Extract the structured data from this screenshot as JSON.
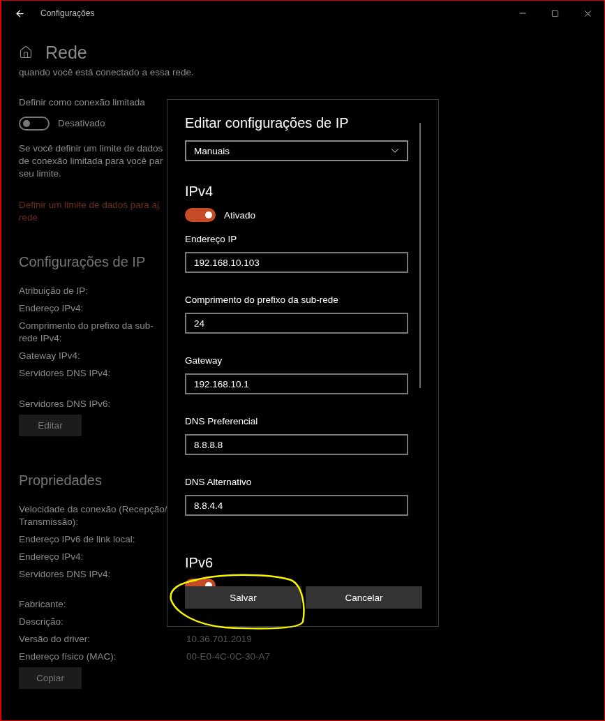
{
  "window": {
    "title": "Configurações"
  },
  "page": {
    "title": "Rede"
  },
  "metered": {
    "intro": "quando você está conectado a essa rede.",
    "label": "Definir como conexão limitada",
    "toggle": {
      "on": false,
      "label": "Desativado"
    },
    "description": [
      "Se você definir um limite de dados",
      "de conexão limitada para você par",
      "seu limite."
    ],
    "link": [
      "Definir um limite de dados para aj",
      "rede"
    ]
  },
  "ip_settings": {
    "title": "Configurações de IP",
    "groups": [
      [
        {
          "label": [
            "Atribuição de IP:"
          ]
        },
        {
          "label": [
            "Endereço IPv4:"
          ]
        },
        {
          "label": [
            "Comprimento do prefixo da sub-",
            "rede IPv4:"
          ]
        },
        {
          "label": [
            "Gateway IPv4:"
          ]
        },
        {
          "label": [
            "Servidores DNS IPv4:"
          ]
        }
      ],
      [
        {
          "label": [
            "Servidores DNS IPv6:"
          ]
        }
      ]
    ],
    "button": "Editar"
  },
  "properties": {
    "title": "Propriedades",
    "groups": [
      [
        {
          "label": [
            "Velocidade da conexão (Recepção/",
            "Transmissão):"
          ]
        },
        {
          "label": [
            "Endereço IPv6 de link local:"
          ]
        },
        {
          "label": [
            "Endereço IPv4:"
          ]
        },
        {
          "label": [
            "Servidores DNS IPv4:"
          ]
        }
      ],
      [
        {
          "label": [
            "Fabricante:"
          ]
        },
        {
          "label": [
            "Descrição:"
          ]
        },
        {
          "label": [
            "Versão do driver:"
          ],
          "value": "10.36.701.2019"
        },
        {
          "label": [
            "Endereço físico (MAC):"
          ],
          "value": "00-E0-4C-0C-30-A7"
        }
      ]
    ],
    "button": "Copiar"
  },
  "dialog": {
    "title": "Editar configurações de IP",
    "mode": "Manuais",
    "ipv4": {
      "heading": "IPv4",
      "toggle": {
        "on": true,
        "label": "Ativado"
      },
      "fields": [
        {
          "label": "Endereço IP",
          "value": "192.168.10.103"
        },
        {
          "label": "Comprimento do prefixo da sub-rede",
          "value": "24"
        },
        {
          "label": "Gateway",
          "value": "192.168.10.1"
        },
        {
          "label": "DNS Preferencial",
          "value": "8.8.8.8"
        },
        {
          "label": "DNS Alternativo",
          "value": "8.8.4.4"
        }
      ]
    },
    "ipv6": {
      "heading": "IPv6",
      "toggle": {
        "on": true
      }
    },
    "buttons": [
      {
        "label": "Salvar"
      },
      {
        "label": "Cancelar"
      }
    ]
  }
}
